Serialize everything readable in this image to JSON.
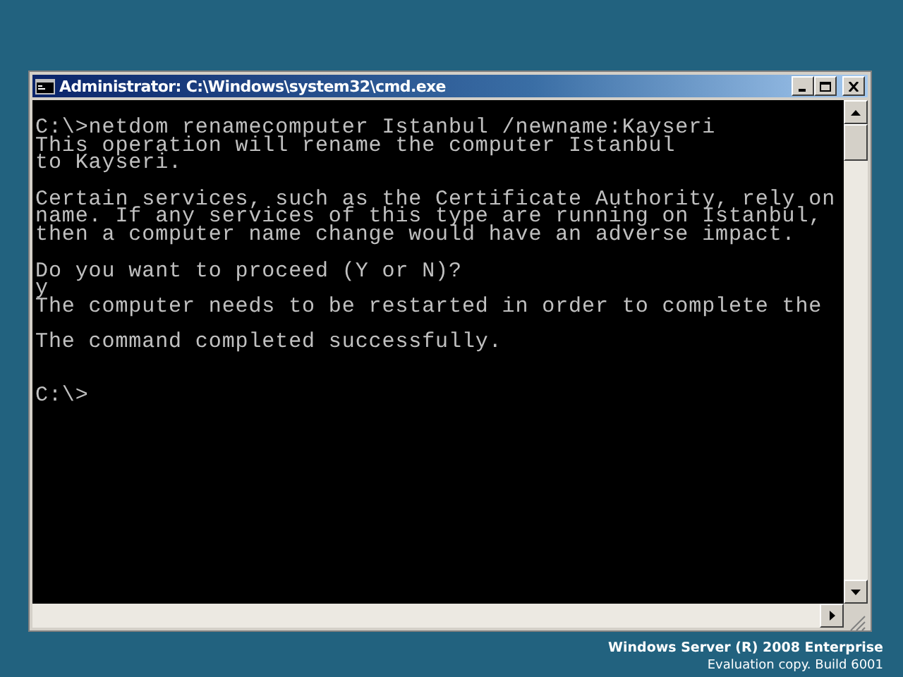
{
  "window": {
    "title": "Administrator: C:\\Windows\\system32\\cmd.exe"
  },
  "console": {
    "lines": [
      {
        "kind": "text",
        "text": "C:\\>netdom renamecomputer Istanbul /newname:Kayseri"
      },
      {
        "kind": "text",
        "text": "This operation will rename the computer Istanbul"
      },
      {
        "kind": "text",
        "text": "to Kayseri."
      },
      {
        "kind": "blank"
      },
      {
        "kind": "text",
        "text": "Certain services, such as the Certificate Authority, rely on"
      },
      {
        "kind": "text",
        "text": "name. If any services of this type are running on Istanbul,"
      },
      {
        "kind": "text",
        "text": "then a computer name change would have an adverse impact."
      },
      {
        "kind": "blank"
      },
      {
        "kind": "text",
        "text": "Do you want to proceed (Y or N)?"
      },
      {
        "kind": "text",
        "text": "y"
      },
      {
        "kind": "text",
        "text": "The computer needs to be restarted in order to complete the"
      },
      {
        "kind": "blank"
      },
      {
        "kind": "text",
        "text": "The command completed successfully."
      },
      {
        "kind": "blank"
      },
      {
        "kind": "blank"
      },
      {
        "kind": "text",
        "text": "C:\\>"
      }
    ]
  },
  "desktop": {
    "edition": "Windows Server (R) 2008 Enterprise",
    "build": "Evaluation copy. Build 6001"
  }
}
